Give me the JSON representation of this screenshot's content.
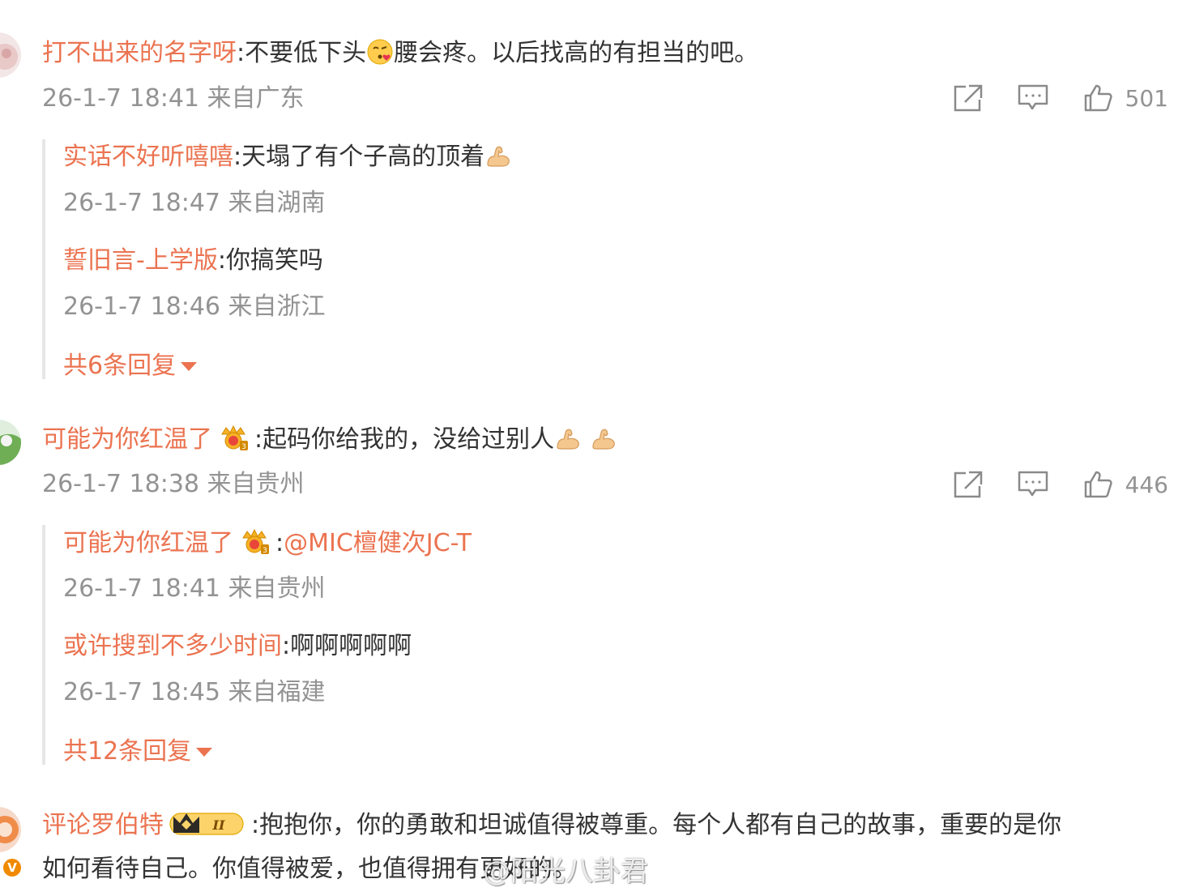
{
  "comments": [
    {
      "username": "打不出来的名字呀",
      "text_before_emoji": "不要低下头",
      "emoji": "kissing-heart-emoji",
      "text_after_emoji": "腰会疼。以后找高的有担当的吧。",
      "meta": "26-1-7 18:41 来自广东",
      "likes": "501",
      "replies": [
        {
          "username": "实话不好听嘻嘻",
          "text": "天塌了有个子高的顶着",
          "emoji": "flexed-biceps-emoji",
          "meta": "26-1-7 18:47 来自湖南"
        },
        {
          "username": "誓旧言-上学版",
          "text": "你搞笑吗",
          "meta": "26-1-7 18:46 来自浙江"
        }
      ],
      "more_replies_label": "共6条回复"
    },
    {
      "username": "可能为你红温了",
      "text": "起码你给我的，没给过别人",
      "meta": "26-1-7 18:38 来自贵州",
      "likes": "446",
      "replies": [
        {
          "username": "可能为你红温了",
          "text": "@MIC檀健次JC-T",
          "meta": "26-1-7 18:41 来自贵州"
        },
        {
          "username": "或许搜到不多少时间",
          "text": "啊啊啊啊啊",
          "meta": "26-1-7 18:45 来自福建"
        }
      ],
      "more_replies_label": "共12条回复"
    },
    {
      "username": "评论罗伯特",
      "text_line1": "抱抱你，你的勇敢和坦诚值得被尊重。每个人都有自己的故事，重要的是你",
      "text_line2": "如何看待自己。你值得被爱，也值得拥有更好的。"
    }
  ],
  "separator": ":",
  "watermark": "@阳光八卦君",
  "verified_badge": "V",
  "badge_level": "II",
  "colors": {
    "username": "#eb7350",
    "meta": "#939393",
    "text": "#333333",
    "reply_border": "#e6e6e6"
  },
  "icons": [
    "share-icon",
    "comment-icon",
    "like-icon",
    "caret-down-icon",
    "crown-badge-icon",
    "vip-level-badge-icon",
    "verified-badge-icon"
  ]
}
